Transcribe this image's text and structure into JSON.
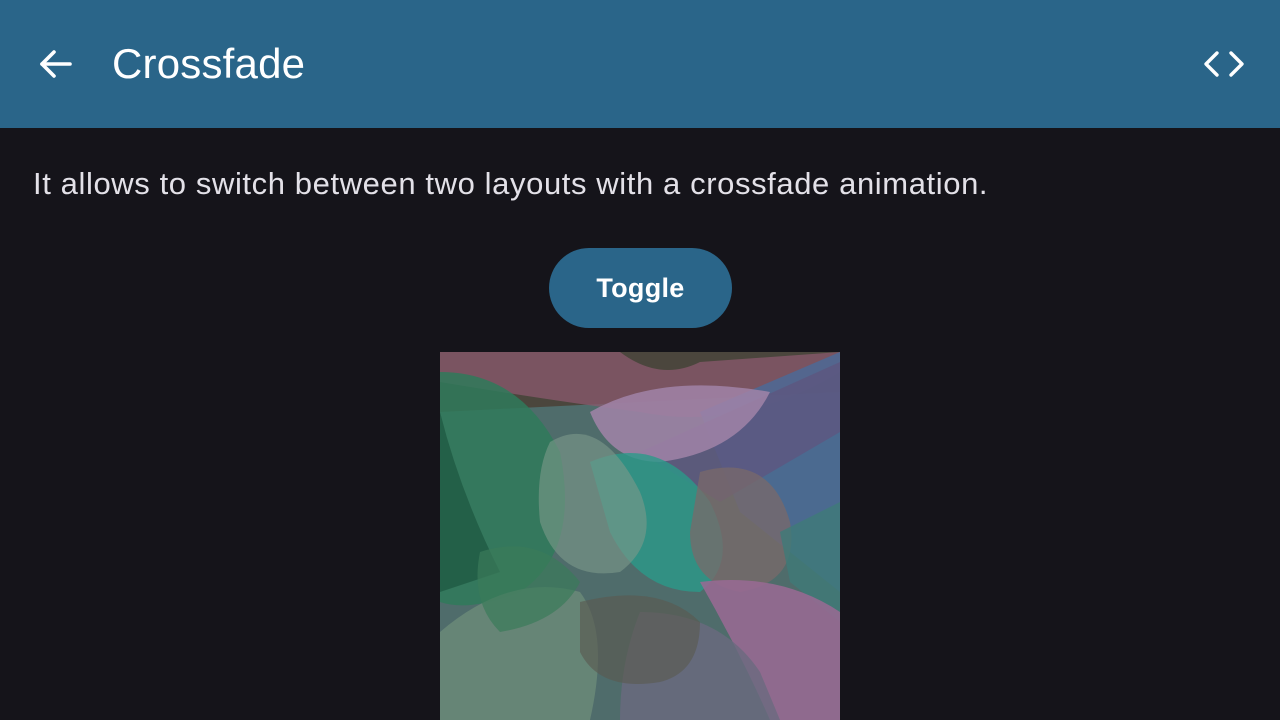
{
  "app_bar": {
    "title": "Crossfade",
    "back_icon": "arrow-back-icon",
    "code_icon": "code-icon",
    "background_color": "#2a6589"
  },
  "main": {
    "description": "It allows to switch between two layouts with a crossfade animation.",
    "toggle_label": "Toggle"
  },
  "colors": {
    "background": "#15141a",
    "accent": "#2a6589",
    "text": "#e3e1e8"
  }
}
